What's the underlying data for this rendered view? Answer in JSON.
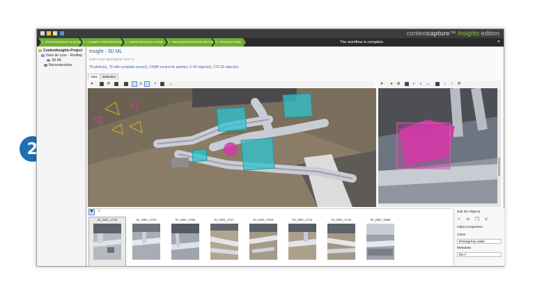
{
  "badge": {
    "number": "2",
    "color": "#1f6fb2"
  },
  "titlebar": {
    "brand_prefix": "context",
    "brand_main": "capture",
    "brand_suffix": "™ ",
    "brand_edition_green": "Insights",
    "brand_edition": " edition"
  },
  "steps": [
    {
      "label": "1 - PHOTOGROUP CLOUDS"
    },
    {
      "label": "2 - CAMERA PROPERTIES"
    },
    {
      "label": "3 - AEROTRIANGULATION"
    },
    {
      "label": "4 - RECONSTRUCTION SETTINGS"
    },
    {
      "label": "5 - PRODUCTION"
    }
  ],
  "workflow_status": "The workflow is complete.",
  "close_icon": "×",
  "tree": {
    "project": "ContextInsights Project",
    "block": "Gare de Lyon - Rooftop",
    "item1": "3D ML",
    "item2": "Reconstruction"
  },
  "panel": {
    "title": "Insight - 3D ML",
    "description_placeholder": "enter your description here",
    "pencil": "✎",
    "stats": "79 photo(s), 79 with complete pose(s), 23580 control tie point(s), 6 3D object(s), 270 2D object(s)"
  },
  "tabs": [
    "View",
    "Detection"
  ],
  "thumbnails": [
    {
      "label": "hz_IMG_1720"
    },
    {
      "label": "hz_IMG_1723"
    },
    {
      "label": "hz_IMG_1766"
    },
    {
      "label": "hz_IMG_1717"
    },
    {
      "label": "hz_IMG_1784"
    },
    {
      "label": "hz_IMG_1714"
    },
    {
      "label": "hz_IMG_1710"
    },
    {
      "label": "hz_IMG_1698"
    }
  ],
  "right_panel": {
    "edit_title": "Edit 2D Objects",
    "props_title": "Object properties",
    "class_label": "Class",
    "class_value": "Emergency valve",
    "metadata_label": "Metadata",
    "metadata_value": "ID=7"
  },
  "colors": {
    "step_green": "#6fae2f",
    "accent_blue": "#2d5f9a",
    "detection_cyan": "#2ec4d0",
    "detection_magenta": "#d23aa6"
  }
}
